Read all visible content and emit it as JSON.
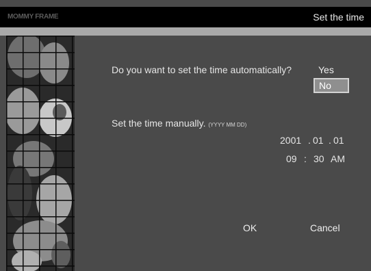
{
  "header": {
    "logo_text": "MOMMY FRAME",
    "title": "Set the time"
  },
  "auto_time": {
    "question": "Do you want to set the time automatically?",
    "options": [
      "Yes",
      "No"
    ],
    "selected": "No"
  },
  "manual": {
    "label": "Set the time manually.",
    "format_hint": "(YYYY MM DD)",
    "year": "2001",
    "month": "01",
    "day": "01",
    "date_sep": ".",
    "hour": "09",
    "minute": "30",
    "time_sep": ":",
    "ampm": "AM"
  },
  "buttons": {
    "ok": "OK",
    "cancel": "Cancel"
  },
  "colors": {
    "background": "#4a4a4a",
    "titlebar": "#000000",
    "stripe": "#a9a9a9",
    "selected_option": "#8f8f8f"
  }
}
